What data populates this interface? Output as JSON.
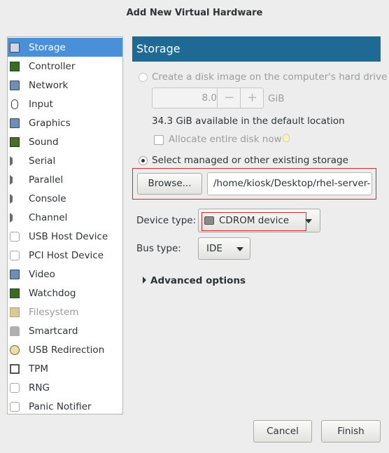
{
  "window": {
    "title": "Add New Virtual Hardware"
  },
  "sidebar": {
    "items": [
      {
        "label": "Storage",
        "icon": "storage-icon",
        "selected": true
      },
      {
        "label": "Controller",
        "icon": "controller-icon"
      },
      {
        "label": "Network",
        "icon": "network-icon"
      },
      {
        "label": "Input",
        "icon": "mouse-icon"
      },
      {
        "label": "Graphics",
        "icon": "graphics-icon"
      },
      {
        "label": "Sound",
        "icon": "sound-icon"
      },
      {
        "label": "Serial",
        "icon": "serial-icon"
      },
      {
        "label": "Parallel",
        "icon": "parallel-icon"
      },
      {
        "label": "Console",
        "icon": "console-icon"
      },
      {
        "label": "Channel",
        "icon": "channel-icon"
      },
      {
        "label": "USB Host Device",
        "icon": "usb-icon"
      },
      {
        "label": "PCI Host Device",
        "icon": "pci-icon"
      },
      {
        "label": "Video",
        "icon": "video-icon"
      },
      {
        "label": "Watchdog",
        "icon": "watchdog-icon"
      },
      {
        "label": "Filesystem",
        "icon": "folder-icon",
        "disabled": true
      },
      {
        "label": "Smartcard",
        "icon": "smartcard-icon"
      },
      {
        "label": "USB Redirection",
        "icon": "usb-redirection-icon"
      },
      {
        "label": "TPM",
        "icon": "chip-icon"
      },
      {
        "label": "RNG",
        "icon": "rng-icon"
      },
      {
        "label": "Panic Notifier",
        "icon": "panic-notifier-icon"
      }
    ]
  },
  "main": {
    "header": "Storage",
    "create_option": {
      "label": "Create a disk image on the computer's hard drive",
      "size_value": "8.0",
      "minus": "−",
      "plus": "+",
      "unit": "GiB",
      "available_text": "34.3 GiB available in the default location",
      "allocate_label": "Allocate entire disk now"
    },
    "select_option": {
      "label": "Select managed or other existing storage",
      "browse_label": "Browse...",
      "path_value": "/home/kiosk/Desktop/rhel-server-"
    },
    "device_type": {
      "label": "Device type:",
      "value": "CDROM device"
    },
    "bus_type": {
      "label": "Bus type:",
      "value": "IDE"
    },
    "advanced_label": "Advanced options"
  },
  "footer": {
    "cancel_label": "Cancel",
    "finish_label": "Finish"
  },
  "colors": {
    "header_bg": "#1f6a95",
    "selection_bg": "#4a90d9",
    "highlight_border": "#d8262c"
  }
}
